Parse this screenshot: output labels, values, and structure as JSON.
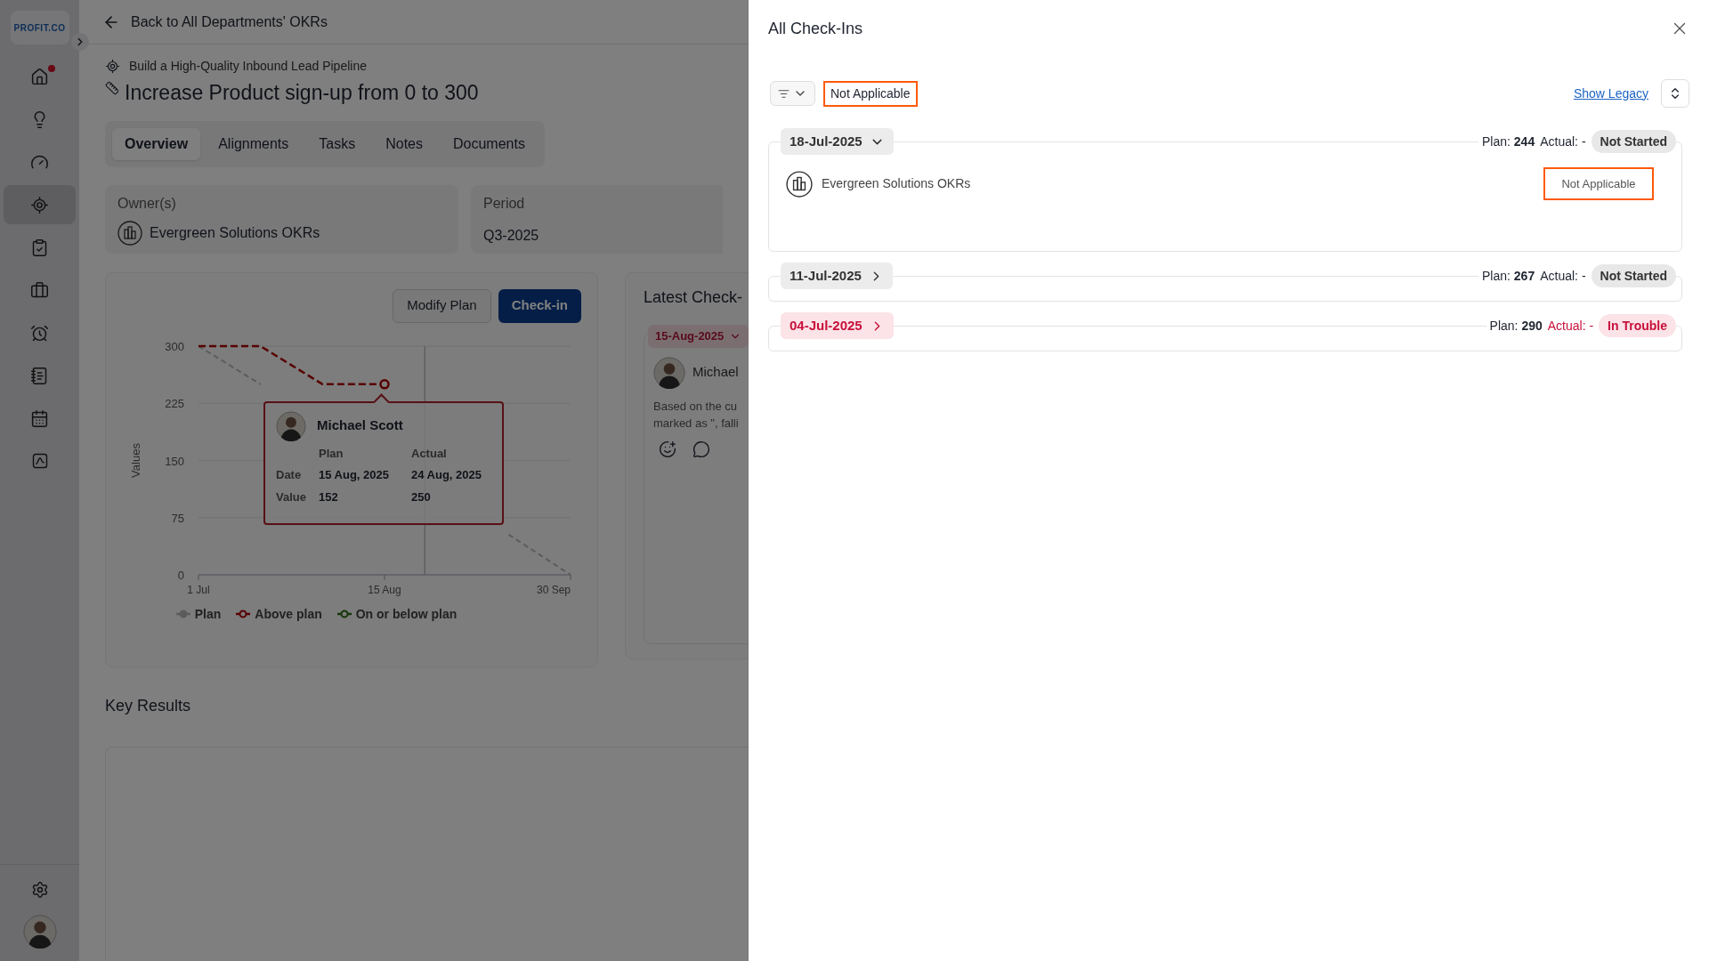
{
  "sidebar": {
    "logo": "PROFIT.CO",
    "nav_items": [
      {
        "selected": false,
        "notification": true
      },
      {
        "selected": false,
        "notification": false
      },
      {
        "selected": false,
        "notification": false
      },
      {
        "selected": true,
        "notification": false
      },
      {
        "selected": false,
        "notification": false
      },
      {
        "selected": false,
        "notification": false
      },
      {
        "selected": false,
        "notification": false
      },
      {
        "selected": false,
        "notification": false
      },
      {
        "selected": false,
        "notification": false
      },
      {
        "selected": false,
        "notification": false
      }
    ]
  },
  "header": {
    "back_link": "Back to All Departments' OKRs"
  },
  "objective": {
    "parent": "Build a High-Quality Inbound Lead Pipeline",
    "title": "Increase Product sign-up from 0 to 300"
  },
  "tabs": [
    {
      "label": "Overview",
      "selected": true
    },
    {
      "label": "Alignments",
      "selected": false
    },
    {
      "label": "Tasks",
      "selected": false
    },
    {
      "label": "Notes",
      "selected": false
    },
    {
      "label": "Documents",
      "selected": false
    }
  ],
  "owner": {
    "label": "Owner(s)",
    "value": "Evergreen Solutions OKRs"
  },
  "period": {
    "label": "Period",
    "value": "Q3-2025"
  },
  "progress_card": {
    "buttons": [
      {
        "label": "Modify Plan",
        "kind": "secondary"
      },
      {
        "label": "Check-in",
        "kind": "primary"
      }
    ],
    "chart_data": {
      "type": "line",
      "ylabel": "Values",
      "categories": [
        "1 Jul",
        null,
        null,
        "15 Aug",
        null,
        null,
        "30 Sep"
      ],
      "series": [
        {
          "name": "Plan",
          "color": "#5c5c5c",
          "line_style": "dashed",
          "values": [
            300,
            250,
            null,
            null,
            null,
            53,
            0
          ]
        },
        {
          "name": "Above plan",
          "color": "#580000",
          "line_style": "dashed",
          "values": [
            300,
            300,
            250,
            250,
            null,
            null,
            null
          ]
        },
        {
          "name": "On or below plan",
          "color": "#17360a",
          "values": [
            null,
            null,
            null,
            null,
            null,
            null,
            null
          ]
        }
      ],
      "ylim": [
        0,
        300
      ],
      "grid": true,
      "yticks": [
        0,
        75,
        150,
        225,
        300
      ]
    },
    "tooltip": {
      "name": "Michael Scott",
      "col_headers": [
        "Plan",
        "Actual"
      ],
      "rows": [
        {
          "label": "Date",
          "plan": "15 Aug, 2025",
          "actual": "24 Aug, 2025"
        },
        {
          "label": "Value",
          "plan": "152",
          "actual": "250"
        }
      ]
    }
  },
  "latest_checkin": {
    "title": "Latest Check-",
    "date": "15-Aug-2025",
    "user": "Michael",
    "note_lines": [
      "Based on the cu",
      "marked as \", falli"
    ]
  },
  "key_results": {
    "title": "Key Results"
  },
  "panel": {
    "title": "All Check-Ins",
    "filter_chip": "Not Applicable",
    "show_legacy": "Show Legacy",
    "checkins": [
      {
        "date": "18-Jul-2025",
        "expanded": true,
        "plan_label": "Plan:",
        "plan": "244",
        "actual_label": "Actual:",
        "actual": "-",
        "status": "Not Started",
        "kind": "not_started",
        "items": [
          {
            "owner": "Evergreen Solutions OKRs",
            "status": "Not Applicable"
          }
        ]
      },
      {
        "date": "11-Jul-2025",
        "expanded": false,
        "plan_label": "Plan:",
        "plan": "267",
        "actual_label": "Actual:",
        "actual": "-",
        "status": "Not Started",
        "kind": "not_started"
      },
      {
        "date": "04-Jul-2025",
        "expanded": false,
        "plan_label": "Plan:",
        "plan": "290",
        "actual_label": "Actual:",
        "actual": "-",
        "status": "In Trouble",
        "kind": "trouble"
      }
    ]
  }
}
